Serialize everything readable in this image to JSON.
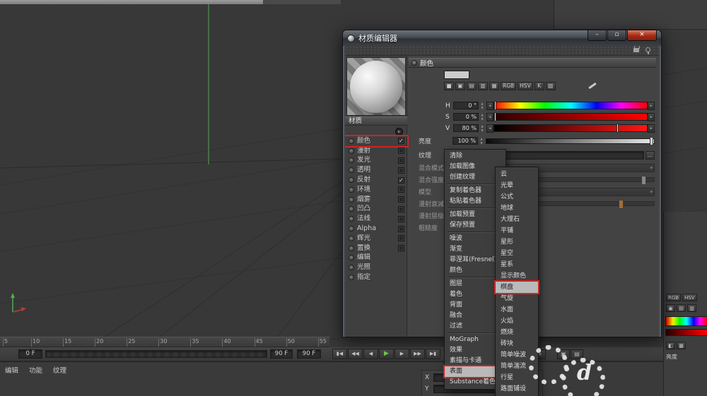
{
  "window": {
    "title": "材质编辑器",
    "buttons": {
      "minimize": "–",
      "maximize": "▫",
      "close": "×"
    }
  },
  "material": {
    "header": "材质",
    "channels": [
      {
        "label": "颜色",
        "checked": true,
        "boxed": true
      },
      {
        "label": "漫射"
      },
      {
        "label": "发光"
      },
      {
        "label": "透明"
      },
      {
        "label": "反射",
        "checked": true
      },
      {
        "label": "环境"
      },
      {
        "label": "烟雾"
      },
      {
        "label": "凹凸"
      },
      {
        "label": "法线"
      },
      {
        "label": "Alpha"
      },
      {
        "label": "辉光"
      },
      {
        "label": "置换"
      },
      {
        "label": "编辑",
        "noCheck": true
      },
      {
        "label": "光照",
        "noCheck": true
      },
      {
        "label": "指定",
        "noCheck": true
      }
    ]
  },
  "color_panel": {
    "header": "颜色",
    "swatch_color": "#cccccc",
    "icon_chips": [
      "■",
      "▣",
      "▤",
      "▥",
      "▦",
      "RGB",
      "HSV",
      "K",
      "▧"
    ],
    "hsv": [
      {
        "label": "H",
        "value": "0 °",
        "cls": "hue m0"
      },
      {
        "label": "S",
        "value": "0 %",
        "cls": "sat m0"
      },
      {
        "label": "V",
        "value": "80 %",
        "cls": "val m80"
      }
    ],
    "brightness": {
      "label": "亮度",
      "value": "100 %"
    },
    "texture": {
      "label": "纹理"
    },
    "disabled_rows": [
      {
        "label": "混合模式",
        "cls": "dd"
      },
      {
        "label": "混合强度",
        "cls": "sl"
      },
      {
        "label": "模型",
        "cls": "dd"
      },
      {
        "label": "漫射衰减",
        "cls": "sl orange"
      },
      {
        "label": "漫射层级",
        "cls": "plain"
      },
      {
        "label": "粗糙度",
        "cls": "plain"
      }
    ]
  },
  "shader_menu": {
    "items": [
      {
        "label": "清除"
      },
      {
        "label": "加载图像"
      },
      {
        "label": "创建纹理"
      },
      {
        "separator": true
      },
      {
        "label": "复制着色器"
      },
      {
        "label": "粘贴着色器"
      },
      {
        "separator": true
      },
      {
        "label": "加载预置",
        "submenu": true
      },
      {
        "label": "保存预置"
      },
      {
        "separator": true
      },
      {
        "label": "噪波"
      },
      {
        "label": "渐变"
      },
      {
        "label": "菲涅耳(Fresnel)"
      },
      {
        "label": "颜色"
      },
      {
        "separator": true
      },
      {
        "label": "图层"
      },
      {
        "label": "着色"
      },
      {
        "label": "背面"
      },
      {
        "label": "融合"
      },
      {
        "label": "过滤"
      },
      {
        "separator": true
      },
      {
        "label": "MoGraph",
        "submenu": true
      },
      {
        "label": "效果",
        "submenu": true
      },
      {
        "label": "素描与卡通",
        "submenu": true
      },
      {
        "label": "表面",
        "submenu": true,
        "selected": true,
        "boxed": true
      },
      {
        "label": "Substance着色器",
        "submenu": true
      }
    ]
  },
  "surface_submenu": {
    "items": [
      {
        "label": "云"
      },
      {
        "label": "光晕"
      },
      {
        "label": "公式"
      },
      {
        "label": "地球"
      },
      {
        "label": "大理石"
      },
      {
        "label": "平铺"
      },
      {
        "label": "星形"
      },
      {
        "label": "星空"
      },
      {
        "label": "星系"
      },
      {
        "label": "显示颜色"
      },
      {
        "label": "棋盘",
        "selected": true,
        "boxed": true
      },
      {
        "label": "气旋"
      },
      {
        "label": "水面"
      },
      {
        "label": "火焰"
      },
      {
        "label": "燃烧"
      },
      {
        "label": "砖块"
      },
      {
        "label": "简单噪波"
      },
      {
        "label": "简单湍流"
      },
      {
        "label": "行星"
      },
      {
        "label": "路面铺设"
      }
    ]
  },
  "timeline": {
    "ticks": [
      "5",
      "10",
      "15",
      "20",
      "25",
      "30",
      "35",
      "40",
      "45",
      "50",
      "55"
    ],
    "range_start": "0 F",
    "range_end": "90 F",
    "current_frame": "90 F",
    "transport": [
      {
        "icon": "▮◀"
      },
      {
        "icon": "◀◀"
      },
      {
        "icon": "◀"
      },
      {
        "icon": "▶",
        "cls": "play"
      },
      {
        "icon": "▶"
      },
      {
        "icon": "▶▶"
      },
      {
        "icon": "▶▮"
      }
    ],
    "record_buttons": [
      {
        "icon": "●",
        "cls": "rec"
      },
      {
        "icon": "◆"
      },
      {
        "icon": "+"
      },
      {
        "icon": "◧"
      },
      {
        "icon": "↺"
      },
      {
        "icon": "▦"
      },
      {
        "icon": "≡"
      }
    ],
    "extra_buttons": [
      {
        "icon": "▣"
      },
      {
        "icon": "▤"
      }
    ]
  },
  "bottom_bar": {
    "tabs": [
      "编辑",
      "功能",
      "纹理"
    ]
  },
  "coords": {
    "rows": [
      {
        "label": "X"
      },
      {
        "label": "Y"
      }
    ]
  },
  "right_dock": {
    "chips": [
      "RGB",
      "HSV"
    ],
    "mini_icons": [
      "▣",
      "▤",
      "▥"
    ],
    "icon_row2": [
      "◧",
      "▦"
    ],
    "brightness_label": "亮度"
  },
  "watermark": {
    "letter": "d"
  },
  "colors": {
    "accent_red": "#cf2323",
    "play_green": "#6ed14e",
    "swatch": "#cccccc"
  }
}
